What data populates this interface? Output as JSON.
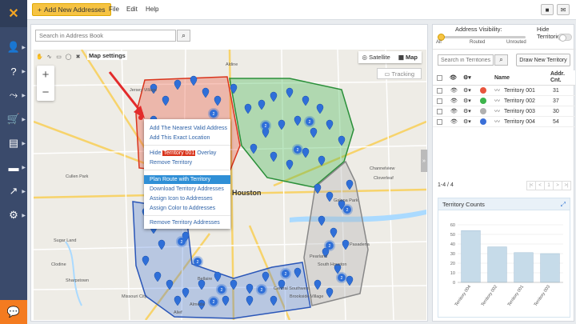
{
  "left_nav": {
    "logo": "route4me-logo",
    "items": [
      {
        "icon": "add-user-icon"
      },
      {
        "icon": "help-icon"
      },
      {
        "icon": "routes-icon"
      },
      {
        "icon": "cart-icon"
      },
      {
        "icon": "addressbook-icon"
      },
      {
        "icon": "truck-icon"
      },
      {
        "icon": "analytics-icon"
      },
      {
        "icon": "user-settings-icon"
      }
    ],
    "chat_icon": "chat-icon"
  },
  "topbar": {
    "add_button": "Add New Addresses",
    "menu": [
      "File",
      "Edit",
      "Help"
    ],
    "icons": [
      "video-icon",
      "message-icon"
    ]
  },
  "map_panel": {
    "search_placeholder": "Search in Address Book",
    "map_settings": "Map settings",
    "map_type": {
      "satellite": "Satellite",
      "map": "Map",
      "selected": "Map"
    },
    "tracking": "Tracking",
    "city_label": "Houston",
    "place_labels": [
      "Jersey Village",
      "Cullen Park",
      "Pasadena",
      "Missouri City",
      "Pearland",
      "Sugar Land",
      "Alief",
      "Bellaire",
      "South Houston",
      "Galena Park",
      "Channelview",
      "Cloverleaf",
      "Aldine",
      "Sharpstown",
      "Almeda",
      "Central Southwest",
      "Brookside Village",
      "Clodine"
    ],
    "context_menu": {
      "items": [
        "Add The Nearest Valid Address",
        "Add This Exact Location",
        "Hide",
        "Remove Territory",
        "Plan Route with Territory",
        "Download Territory Addresses",
        "Assign Icon to Addresses",
        "Assign Color to Addresses",
        "Remove Territory Addresses"
      ],
      "hide_territory": "Territory 001",
      "hide_suffix": "Overlay",
      "highlighted": "Plan Route with Territory"
    },
    "territories": [
      {
        "name": "Territory 001",
        "color": "#e8553d"
      },
      {
        "name": "Territory 002",
        "color": "#3cb44b"
      },
      {
        "name": "Territory 003",
        "color": "#a9a9a9"
      },
      {
        "name": "Territory 004",
        "color": "#3a6fd8"
      }
    ]
  },
  "right_panel": {
    "address_visibility": {
      "label": "Address Visibility:",
      "ticks": [
        "All",
        "Routed",
        "Unrouted"
      ],
      "selected": "All"
    },
    "hide_territories": {
      "label": "Hide Territories:",
      "on": false
    },
    "search_placeholder": "Search in Territories",
    "new_territory_button": "Draw New Territory",
    "table": {
      "headers": [
        "Name",
        "Addr. Cnt."
      ],
      "rows": [
        {
          "name": "Territory 001",
          "count": "31",
          "color": "#e8553d"
        },
        {
          "name": "Territory 002",
          "count": "37",
          "color": "#3cb44b"
        },
        {
          "name": "Territory 003",
          "count": "30",
          "color": "#b0b0b0"
        },
        {
          "name": "Territory 004",
          "count": "54",
          "color": "#3a6fd8"
        }
      ]
    },
    "pager": {
      "info": "1-4 / 4",
      "controls": [
        "|<",
        "<",
        "1",
        ">",
        ">|"
      ]
    },
    "chart_title": "Territory Counts"
  },
  "chart_data": {
    "type": "bar",
    "title": "Territory Counts",
    "categories": [
      "Territory 004",
      "Territory 002",
      "Territory 001",
      "Territory 003"
    ],
    "values": [
      54,
      37,
      31,
      30
    ],
    "ylim": [
      0,
      60
    ],
    "yticks": [
      0,
      10,
      20,
      30,
      40,
      50,
      60
    ],
    "grid": true,
    "legend": "none",
    "bar_color": "#c6dbe9"
  }
}
